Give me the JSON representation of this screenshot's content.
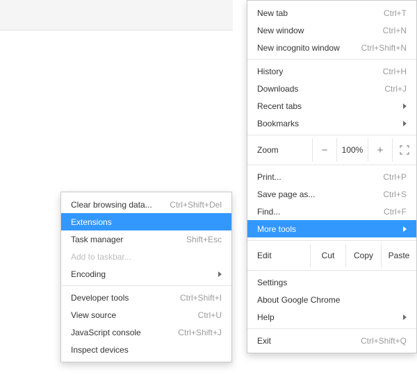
{
  "main_menu": {
    "new_tab": {
      "label": "New tab",
      "shortcut": "Ctrl+T"
    },
    "new_window": {
      "label": "New window",
      "shortcut": "Ctrl+N"
    },
    "new_incognito": {
      "label": "New incognito window",
      "shortcut": "Ctrl+Shift+N"
    },
    "history": {
      "label": "History",
      "shortcut": "Ctrl+H"
    },
    "downloads": {
      "label": "Downloads",
      "shortcut": "Ctrl+J"
    },
    "recent_tabs": {
      "label": "Recent tabs"
    },
    "bookmarks": {
      "label": "Bookmarks"
    },
    "zoom": {
      "label": "Zoom",
      "value": "100%"
    },
    "print": {
      "label": "Print...",
      "shortcut": "Ctrl+P"
    },
    "save_as": {
      "label": "Save page as...",
      "shortcut": "Ctrl+S"
    },
    "find": {
      "label": "Find...",
      "shortcut": "Ctrl+F"
    },
    "more_tools": {
      "label": "More tools"
    },
    "edit": {
      "label": "Edit",
      "cut": "Cut",
      "copy": "Copy",
      "paste": "Paste"
    },
    "settings": {
      "label": "Settings"
    },
    "about": {
      "label": "About Google Chrome"
    },
    "help": {
      "label": "Help"
    },
    "exit": {
      "label": "Exit",
      "shortcut": "Ctrl+Shift+Q"
    }
  },
  "sub_menu": {
    "clear_data": {
      "label": "Clear browsing data...",
      "shortcut": "Ctrl+Shift+Del"
    },
    "extensions": {
      "label": "Extensions"
    },
    "task_manager": {
      "label": "Task manager",
      "shortcut": "Shift+Esc"
    },
    "add_taskbar": {
      "label": "Add to taskbar..."
    },
    "encoding": {
      "label": "Encoding"
    },
    "dev_tools": {
      "label": "Developer tools",
      "shortcut": "Ctrl+Shift+I"
    },
    "view_source": {
      "label": "View source",
      "shortcut": "Ctrl+U"
    },
    "js_console": {
      "label": "JavaScript console",
      "shortcut": "Ctrl+Shift+J"
    },
    "inspect": {
      "label": "Inspect devices"
    }
  }
}
